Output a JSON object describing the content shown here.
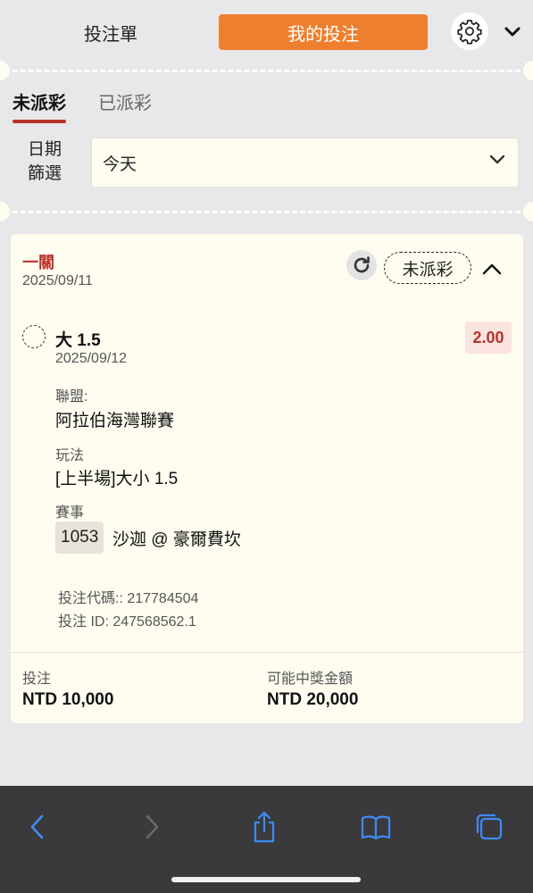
{
  "header": {
    "tab_betslip": "投注單",
    "tab_mybets": "我的投注",
    "accent_color": "#ee7f2e"
  },
  "status_tabs": [
    {
      "label": "未派彩",
      "active": true
    },
    {
      "label": "已派彩",
      "active": false
    }
  ],
  "date_filter": {
    "label": "日期\n篩選",
    "label_line1": "日期",
    "label_line2": "篩選",
    "selected": "今天"
  },
  "bet": {
    "type": "一關",
    "placed_date": "2025/09/11",
    "status": "未派彩",
    "selection": {
      "name": "大 1.5",
      "date": "2025/09/12",
      "odds": "2.00",
      "league_label": "聯盟:",
      "league": "阿拉伯海灣聯賽",
      "market_label": "玩法",
      "market": "[上半場]大小 1.5",
      "event_label": "賽事",
      "event_id": "1053",
      "event_name": "沙迦 @ 豪爾費坎"
    },
    "bet_code": "投注代碼:: 217784504",
    "bet_id": "投注 ID: 247568562.1",
    "stake_label": "投注",
    "stake": "NTD 10,000",
    "payout_label": "可能中獎金額",
    "payout": "NTD 20,000"
  },
  "browser_toolbar": {
    "icons": [
      "back-icon",
      "forward-icon",
      "share-icon",
      "bookmarks-icon",
      "tabs-icon"
    ],
    "icon_color": "#3d8cf5"
  }
}
